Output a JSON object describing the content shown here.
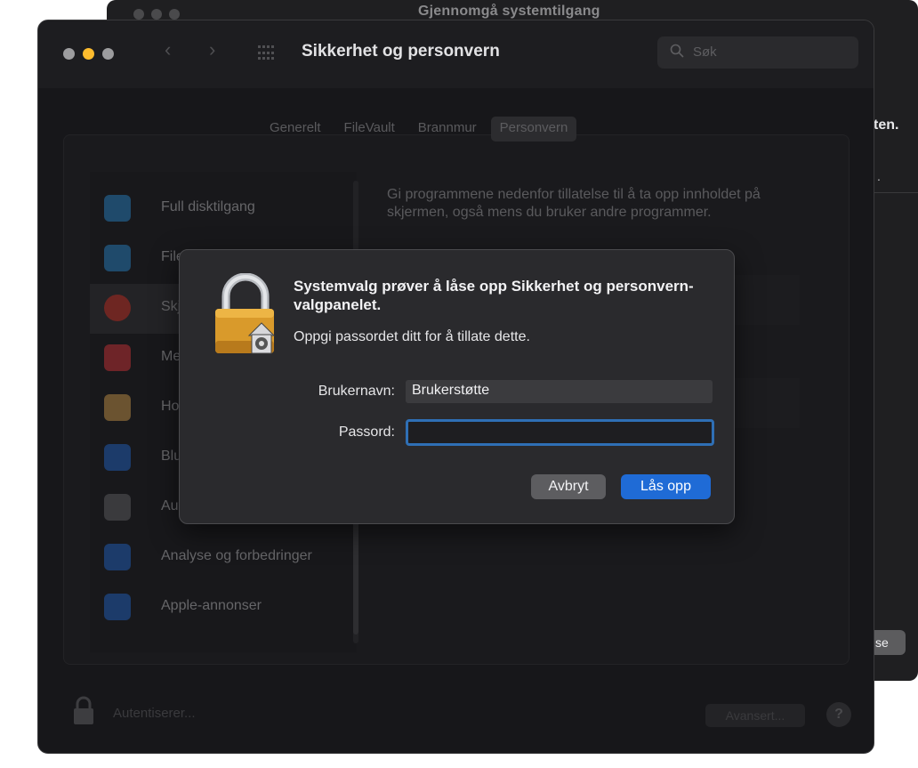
{
  "background_window": {
    "title": "Gjennomgå systemtilgang",
    "right_heading_fragment": "ten.",
    "right_dot": ".",
    "right_button_fragment": "se"
  },
  "window": {
    "title": "Sikkerhet og personvern",
    "search_placeholder": "Søk"
  },
  "tabs": [
    {
      "label": "Generelt"
    },
    {
      "label": "FileVault"
    },
    {
      "label": "Brannmur"
    },
    {
      "label": "Personvern"
    }
  ],
  "sidebar": {
    "items": [
      {
        "label": "Full disktilgang",
        "icon": "folder-icon",
        "color": "#3b8ac4"
      },
      {
        "label": "Filer",
        "icon": "folder-icon",
        "color": "#3b8ac4"
      },
      {
        "label": "Skjerm",
        "icon": "screen-record-icon",
        "color": "#d8433a"
      },
      {
        "label": "Medier",
        "icon": "music-icon",
        "color": "#e0434b"
      },
      {
        "label": "Hom",
        "icon": "home-icon",
        "color": "#e9a33a"
      },
      {
        "label": "Blue",
        "icon": "bluetooth-icon",
        "color": "#2a6fd0"
      },
      {
        "label": "Aut",
        "icon": "gear-icon",
        "color": "#8a8a8d"
      },
      {
        "label": "Analyse og forbedringer",
        "icon": "chart-icon",
        "color": "#2a6fd0"
      },
      {
        "label": "Apple-annonser",
        "icon": "megaphone-icon",
        "color": "#2a6fd0"
      }
    ]
  },
  "description": "Gi programmene nedenfor tillatelse til å ta opp innholdet på skjermen, også mens du bruker andre programmer.",
  "footer": {
    "auth_label": "Autentiserer...",
    "advanced_label": "Avansert...",
    "help_label": "?"
  },
  "dialog": {
    "heading": "Systemvalg prøver å låse opp Sikkerhet og personvern-valgpanelet.",
    "subtext": "Oppgi passordet ditt for å tillate dette.",
    "username_label": "Brukernavn:",
    "username_value": "Brukerstøtte",
    "password_label": "Passord:",
    "password_value": "",
    "cancel_label": "Avbryt",
    "unlock_label": "Lås opp",
    "accent_color": "#1f6bd6"
  }
}
